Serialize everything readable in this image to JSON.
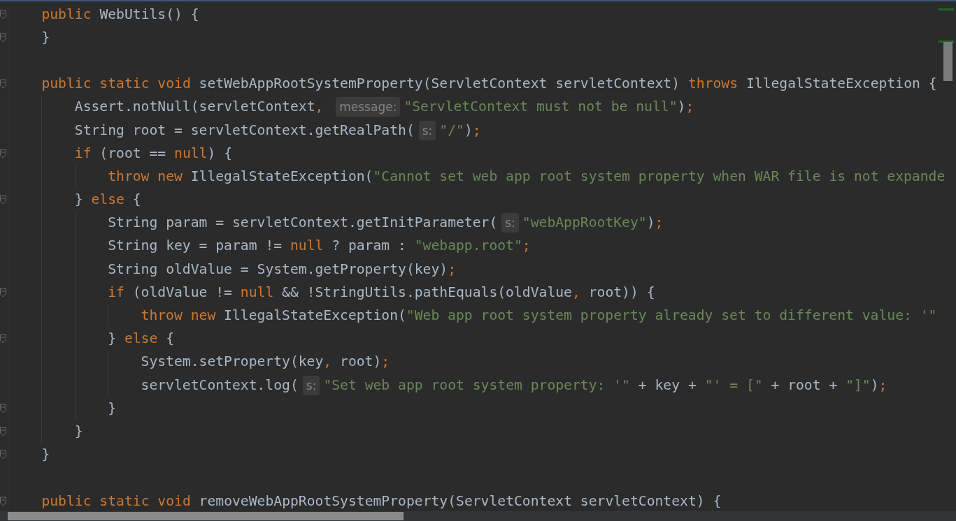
{
  "editor": {
    "lines": [
      {
        "fold": true,
        "tokens": [
          {
            "kind": "keyword",
            "text": "public "
          },
          {
            "kind": "text",
            "text": "WebUtils() {"
          }
        ]
      },
      {
        "fold": true,
        "tokens": [
          {
            "kind": "text",
            "text": "}"
          }
        ]
      },
      {
        "fold": true,
        "gap_before": true,
        "tokens": [
          {
            "kind": "keyword",
            "text": "public static void "
          },
          {
            "kind": "text",
            "text": "setWebAppRootSystemProperty(ServletContext servletContext) "
          },
          {
            "kind": "keyword",
            "text": "throws "
          },
          {
            "kind": "text",
            "text": "IllegalStateException {"
          }
        ],
        "children": [
          {
            "tokens": [
              {
                "kind": "text",
                "text": "Assert.notNull(servletContext"
              },
              {
                "kind": "punct",
                "text": ", "
              },
              {
                "kind": "hint",
                "text": "message:"
              },
              {
                "kind": "string",
                "text": "\"ServletContext must not be null\""
              },
              {
                "kind": "text",
                "text": ")"
              },
              {
                "kind": "punct",
                "text": ";"
              }
            ]
          },
          {
            "tokens": [
              {
                "kind": "text",
                "text": "String root = servletContext.getRealPath("
              },
              {
                "kind": "hint",
                "text": "s:"
              },
              {
                "kind": "string",
                "text": "\"/\""
              },
              {
                "kind": "text",
                "text": ")"
              },
              {
                "kind": "punct",
                "text": ";"
              }
            ]
          },
          {
            "fold": true,
            "tokens": [
              {
                "kind": "keyword",
                "text": "if "
              },
              {
                "kind": "text",
                "text": "(root == "
              },
              {
                "kind": "keyword",
                "text": "null"
              },
              {
                "kind": "text",
                "text": ") {"
              }
            ],
            "children": [
              {
                "tokens": [
                  {
                    "kind": "keyword",
                    "text": "throw new "
                  },
                  {
                    "kind": "text",
                    "text": "IllegalStateException("
                  },
                  {
                    "kind": "string",
                    "text": "\"Cannot set web app root system property when WAR file is not expande"
                  }
                ]
              }
            ]
          },
          {
            "fold": true,
            "tokens": [
              {
                "kind": "text",
                "text": "} "
              },
              {
                "kind": "keyword",
                "text": "else "
              },
              {
                "kind": "text",
                "text": "{"
              }
            ],
            "children": [
              {
                "tokens": [
                  {
                    "kind": "text",
                    "text": "String param = servletContext.getInitParameter("
                  },
                  {
                    "kind": "hint",
                    "text": "s:"
                  },
                  {
                    "kind": "string",
                    "text": "\"webAppRootKey\""
                  },
                  {
                    "kind": "text",
                    "text": ")"
                  },
                  {
                    "kind": "punct",
                    "text": ";"
                  }
                ]
              },
              {
                "tokens": [
                  {
                    "kind": "text",
                    "text": "String key = param != "
                  },
                  {
                    "kind": "keyword",
                    "text": "null "
                  },
                  {
                    "kind": "text",
                    "text": "? param : "
                  },
                  {
                    "kind": "string",
                    "text": "\"webapp.root\""
                  },
                  {
                    "kind": "punct",
                    "text": ";"
                  }
                ]
              },
              {
                "tokens": [
                  {
                    "kind": "text",
                    "text": "String oldValue = System.getProperty(key)"
                  },
                  {
                    "kind": "punct",
                    "text": ";"
                  }
                ]
              },
              {
                "fold": true,
                "tokens": [
                  {
                    "kind": "keyword",
                    "text": "if "
                  },
                  {
                    "kind": "text",
                    "text": "(oldValue != "
                  },
                  {
                    "kind": "keyword",
                    "text": "null "
                  },
                  {
                    "kind": "text",
                    "text": "&& !StringUtils.pathEquals(oldValue"
                  },
                  {
                    "kind": "punct",
                    "text": ", "
                  },
                  {
                    "kind": "text",
                    "text": "root)) {"
                  }
                ],
                "children": [
                  {
                    "tokens": [
                      {
                        "kind": "keyword",
                        "text": "throw new "
                      },
                      {
                        "kind": "text",
                        "text": "IllegalStateException("
                      },
                      {
                        "kind": "string",
                        "text": "\"Web app root system property already set to different value: '\""
                      }
                    ]
                  }
                ]
              },
              {
                "fold": true,
                "tokens": [
                  {
                    "kind": "text",
                    "text": "} "
                  },
                  {
                    "kind": "keyword",
                    "text": "else "
                  },
                  {
                    "kind": "text",
                    "text": "{"
                  }
                ],
                "children": [
                  {
                    "tokens": [
                      {
                        "kind": "text",
                        "text": "System.setProperty(key"
                      },
                      {
                        "kind": "punct",
                        "text": ", "
                      },
                      {
                        "kind": "text",
                        "text": "root)"
                      },
                      {
                        "kind": "punct",
                        "text": ";"
                      }
                    ]
                  },
                  {
                    "tokens": [
                      {
                        "kind": "text",
                        "text": "servletContext.log("
                      },
                      {
                        "kind": "hint",
                        "text": "s:"
                      },
                      {
                        "kind": "string",
                        "text": "\"Set web app root system property: '\""
                      },
                      {
                        "kind": "text",
                        "text": " + key + "
                      },
                      {
                        "kind": "string",
                        "text": "\"' = [\""
                      },
                      {
                        "kind": "text",
                        "text": " + root + "
                      },
                      {
                        "kind": "string",
                        "text": "\"]\""
                      },
                      {
                        "kind": "text",
                        "text": ")"
                      },
                      {
                        "kind": "punct",
                        "text": ";"
                      }
                    ]
                  }
                ]
              },
              {
                "fold": true,
                "tokens": [
                  {
                    "kind": "text",
                    "text": "}"
                  }
                ]
              }
            ]
          },
          {
            "fold": true,
            "tokens": [
              {
                "kind": "text",
                "text": "}"
              }
            ]
          }
        ]
      },
      {
        "fold": true,
        "tokens": [
          {
            "kind": "text",
            "text": "}"
          }
        ]
      },
      {
        "fold": true,
        "gap_before": true,
        "tokens": [
          {
            "kind": "keyword",
            "text": "public static void "
          },
          {
            "kind": "text",
            "text": "removeWebAppRootSystemProperty(ServletContext servletContext) {"
          }
        ]
      }
    ]
  }
}
